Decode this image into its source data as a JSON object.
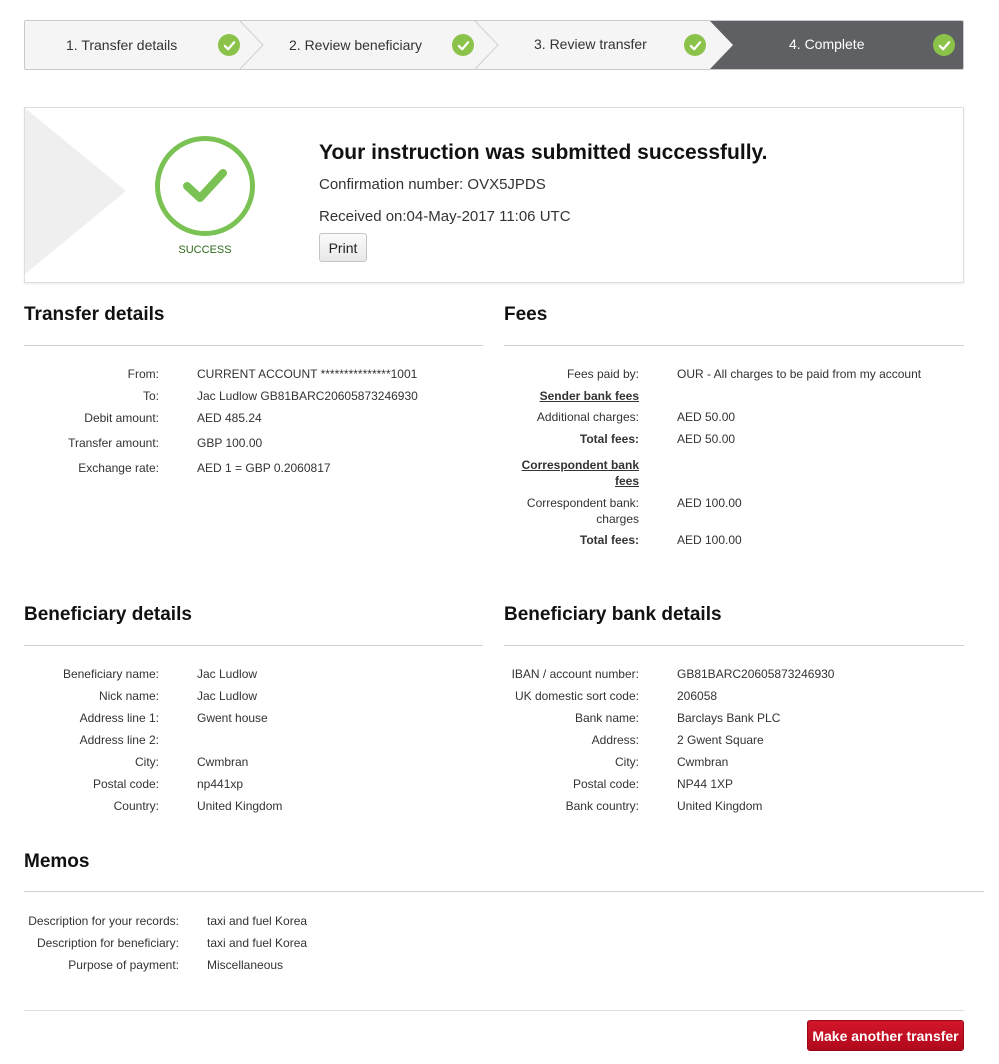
{
  "stepper": {
    "steps": [
      {
        "label": "1. Transfer details"
      },
      {
        "label": "2. Review beneficiary"
      },
      {
        "label": "3. Review transfer"
      },
      {
        "label": "4. Complete"
      }
    ],
    "colors": {
      "done_bg": "#f3f3f3",
      "active_bg": "#5f6064",
      "check": "#8bc34a"
    }
  },
  "success": {
    "icon": "success-check-icon",
    "status": "SUCCESS",
    "heading": "Your instruction was submitted successfully.",
    "confirmation": "Confirmation number: OVX5JPDS",
    "received": "Received on:04-May-2017 11:06 UTC",
    "print_label": "Print",
    "colors": {
      "ring": "#7bc254",
      "status": "#2e6b1a"
    }
  },
  "transfer_details": {
    "title": "Transfer details",
    "rows": [
      {
        "k": "From:",
        "v": "CURRENT ACCOUNT ***************1001"
      },
      {
        "k": "To:",
        "v": "Jac Ludlow GB81BARC20605873246930"
      },
      {
        "k": "Debit amount:",
        "v": "AED 485.24"
      },
      {
        "k": "Transfer amount:",
        "v": "GBP 100.00"
      },
      {
        "k": "Exchange rate:",
        "v": "AED 1 = GBP 0.2060817"
      }
    ]
  },
  "fees": {
    "title": "Fees",
    "paid_by_k": "Fees paid by:",
    "paid_by_v": "OUR - All charges to be paid from my account",
    "sender_heading": "Sender bank fees",
    "additional_k": "Additional charges:",
    "additional_v": "AED 50.00",
    "total1_k": "Total fees:",
    "total1_v": "AED 50.00",
    "corr_heading_1": "Correspondent bank",
    "corr_heading_2": "fees",
    "corr_charges_k1": "Correspondent bank:",
    "corr_charges_k2": "charges",
    "corr_charges_v": "AED 100.00",
    "total2_k": "Total fees:",
    "total2_v": "AED 100.00"
  },
  "beneficiary": {
    "title": "Beneficiary details",
    "rows": [
      {
        "k": "Beneficiary name:",
        "v": "Jac Ludlow"
      },
      {
        "k": "Nick name:",
        "v": "Jac Ludlow"
      },
      {
        "k": "Address line 1:",
        "v": "Gwent house"
      },
      {
        "k": "Address line 2:",
        "v": ""
      },
      {
        "k": "City:",
        "v": "Cwmbran"
      },
      {
        "k": "Postal code:",
        "v": "np441xp"
      },
      {
        "k": "Country:",
        "v": "United Kingdom"
      }
    ]
  },
  "bank": {
    "title": "Beneficiary bank details",
    "rows": [
      {
        "k": "IBAN / account number:",
        "v": "GB81BARC20605873246930"
      },
      {
        "k": "UK domestic sort code:",
        "v": "206058"
      },
      {
        "k": "Bank name:",
        "v": "Barclays Bank PLC"
      },
      {
        "k": "Address:",
        "v": "2 Gwent Square"
      },
      {
        "k": "City:",
        "v": "Cwmbran"
      },
      {
        "k": "Postal code:",
        "v": "NP44 1XP"
      },
      {
        "k": "Bank country:",
        "v": "United Kingdom"
      }
    ]
  },
  "memos": {
    "title": "Memos",
    "rows": [
      {
        "k": "Description for your records:",
        "v": "taxi and fuel Korea"
      },
      {
        "k": "Description for beneficiary:",
        "v": "taxi and fuel Korea"
      },
      {
        "k": "Purpose of payment:",
        "v": "Miscellaneous"
      }
    ]
  },
  "actions": {
    "again_label": "Make another transfer",
    "again_color": "#c8102e"
  }
}
